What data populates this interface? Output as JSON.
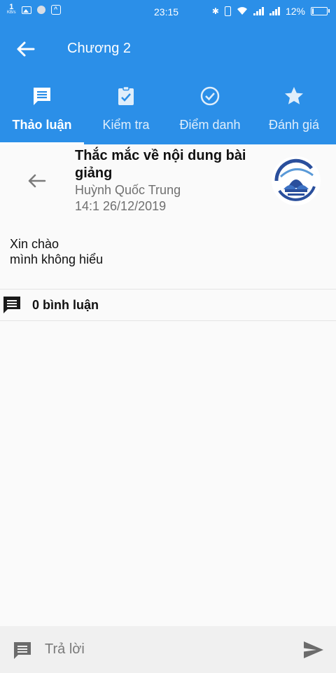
{
  "status_bar": {
    "speed_value": "1",
    "speed_unit": "KB/s",
    "time": "23:15",
    "battery": "12%"
  },
  "app_bar": {
    "title": "Chương 2"
  },
  "tabs": [
    {
      "label": "Thảo luận",
      "icon": "forum-icon",
      "active": true
    },
    {
      "label": "Kiểm tra",
      "icon": "assignment-check-icon",
      "active": false
    },
    {
      "label": "Điểm danh",
      "icon": "check-circle-icon",
      "active": false
    },
    {
      "label": "Đánh giá",
      "icon": "star-icon",
      "active": false
    }
  ],
  "post": {
    "title": "Thắc mắc về nội dung bài giảng",
    "author": "Huỳnh Quốc Trung",
    "time": "14:1 26/12/2019",
    "body_lines": [
      "Xin chào",
      "mình không hiểu"
    ]
  },
  "comments": {
    "count_label": "0 bình luận"
  },
  "reply": {
    "placeholder": "Trả lời"
  },
  "colors": {
    "primary": "#2b8fe8",
    "background": "#fafafa",
    "reply_bar": "#f0f0f0",
    "muted_text": "#707070"
  }
}
